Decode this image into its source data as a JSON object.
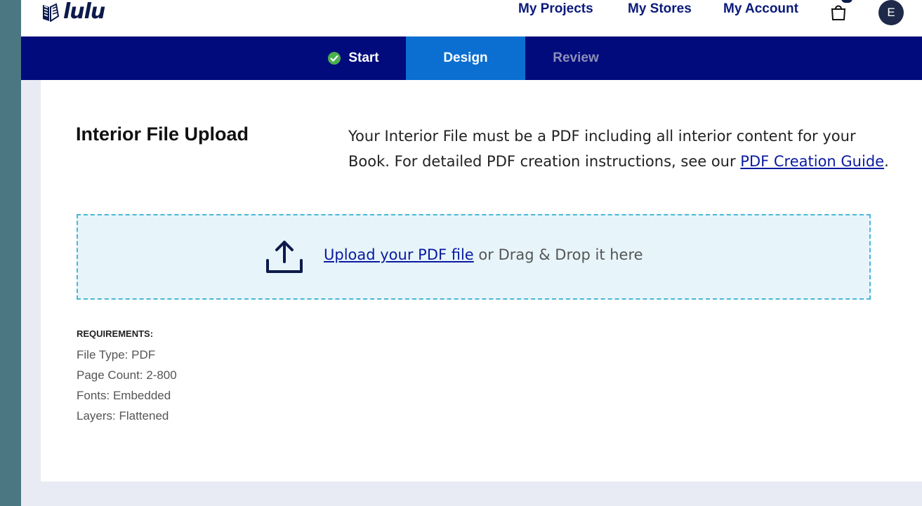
{
  "brand": {
    "logo_text": "lulu",
    "logo_icon": "book-icon"
  },
  "topnav": {
    "my_projects": "My Projects",
    "my_stores": "My Stores",
    "my_account": "My Account",
    "cart_icon": "shopping-bag-icon",
    "avatar_initial": "E"
  },
  "steps": [
    {
      "label": "Start",
      "state": "complete"
    },
    {
      "label": "Design",
      "state": "active"
    },
    {
      "label": "Review",
      "state": "inactive"
    }
  ],
  "upload_section": {
    "title": "Interior File Upload",
    "description_before": "Your Interior File must be a PDF including all interior content for your Book. For detailed PDF creation instructions, see our ",
    "guide_link": "PDF Creation Guide",
    "description_after": "."
  },
  "dropzone": {
    "upload_link": "Upload your PDF file",
    "upload_suffix": " or Drag & Drop it here"
  },
  "requirements": {
    "heading": "REQUIREMENTS:",
    "items": [
      "File Type: PDF",
      "Page Count: 2-800",
      "Fonts: Embedded",
      "Layers: Flattened"
    ]
  },
  "colors": {
    "nav_blue": "#020b7c",
    "active_step": "#0a6fd1",
    "complete_check": "#4caf50",
    "link": "#0a1aa0",
    "dropzone_border": "#4ab6d6",
    "dropzone_bg": "#e7f5fa"
  }
}
